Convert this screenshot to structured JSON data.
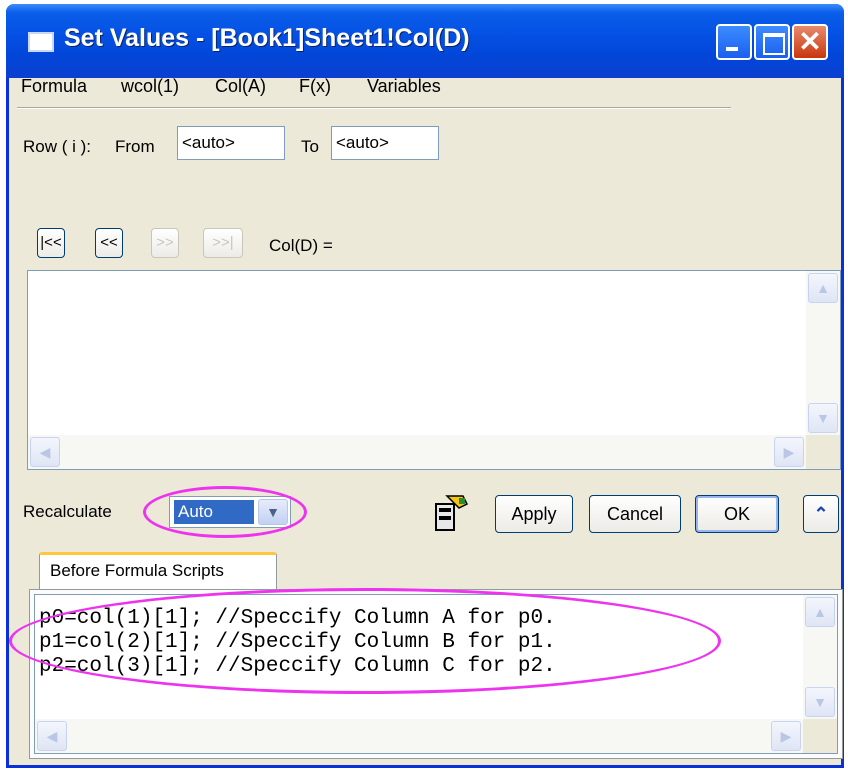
{
  "window": {
    "title": "Set Values - [Book1]Sheet1!Col(D)"
  },
  "menu": [
    "Formula",
    "wcol(1)",
    "Col(A)",
    "F(x)",
    "Variables"
  ],
  "row_range": {
    "label": "Row ( i ):",
    "from_label": "From",
    "from_value": "<auto>",
    "to_label": "To",
    "to_value": "<auto>"
  },
  "nav": {
    "first": "|<<",
    "prev": "<<",
    "next": ">>",
    "last": ">>|",
    "column_label": "Col(D) ="
  },
  "formula": {
    "value": ""
  },
  "recalculate": {
    "label": "Recalculate",
    "selected": "Auto"
  },
  "buttons": {
    "apply": "Apply",
    "cancel": "Cancel",
    "ok": "OK"
  },
  "script_tab": {
    "label": "Before Formula Scripts"
  },
  "script_lines": [
    "p0=col(1)[1]; //Speccify Column A for p0.",
    "p1=col(2)[1]; //Speccify Column B for p1.",
    "p2=col(3)[1]; //Speccify Column C for p2."
  ],
  "icons": {
    "window_icon": "window-icon",
    "minimize": "minimize-icon",
    "maximize": "maximize-icon",
    "close": "close-icon",
    "fill_tool": "fill-cells-icon",
    "collapse": "collapse-up-icon",
    "dropdown": "chevron-down-icon"
  },
  "colors": {
    "title_bar": "#0551e5",
    "dialog_bg": "#ece9d8",
    "highlight": "#ee33ee",
    "selection": "#316ac5"
  }
}
